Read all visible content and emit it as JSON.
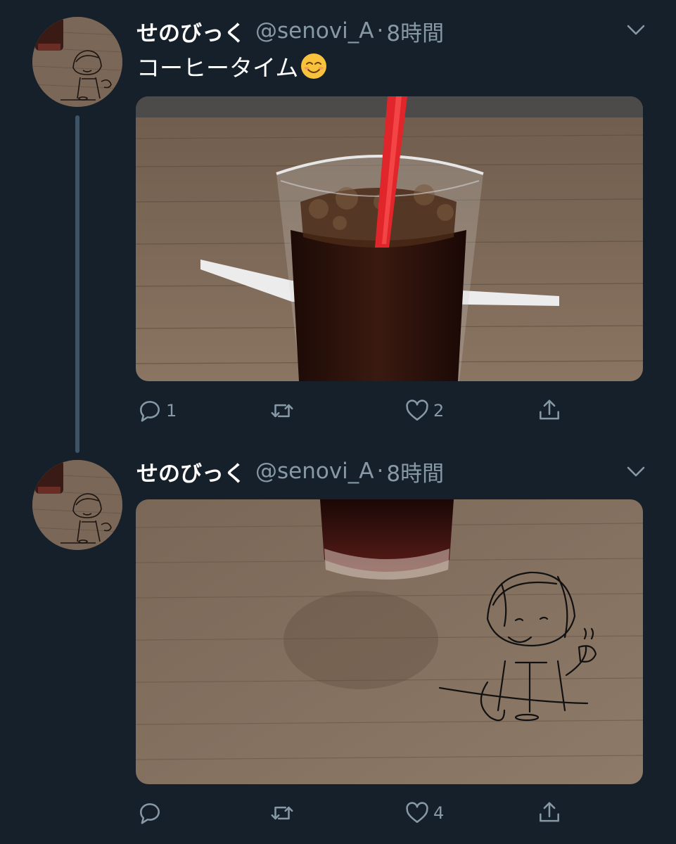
{
  "tweets": [
    {
      "author_name": "せのびっく",
      "handle": "@senovi_A",
      "separator": "·",
      "time": "8時間",
      "text": "コーヒータイム",
      "emoji": "smiling-face-emoji",
      "media": "photo-iced-coffee-glass-with-red-straw",
      "reply_count": "1",
      "retweet_count": "",
      "like_count": "2"
    },
    {
      "author_name": "せのびっく",
      "handle": "@senovi_A",
      "separator": "·",
      "time": "8時間",
      "media": "photo-coffee-glass-and-drawn-character-on-table",
      "reply_count": "",
      "retweet_count": "",
      "like_count": "4"
    }
  ],
  "icons": {
    "reply": "reply-icon",
    "retweet": "retweet-icon",
    "like": "heart-icon",
    "share": "share-icon",
    "menu": "chevron-down-icon"
  },
  "colors": {
    "background": "#15202b",
    "secondary_text": "#8899a6",
    "thread_line": "#3d5466"
  }
}
